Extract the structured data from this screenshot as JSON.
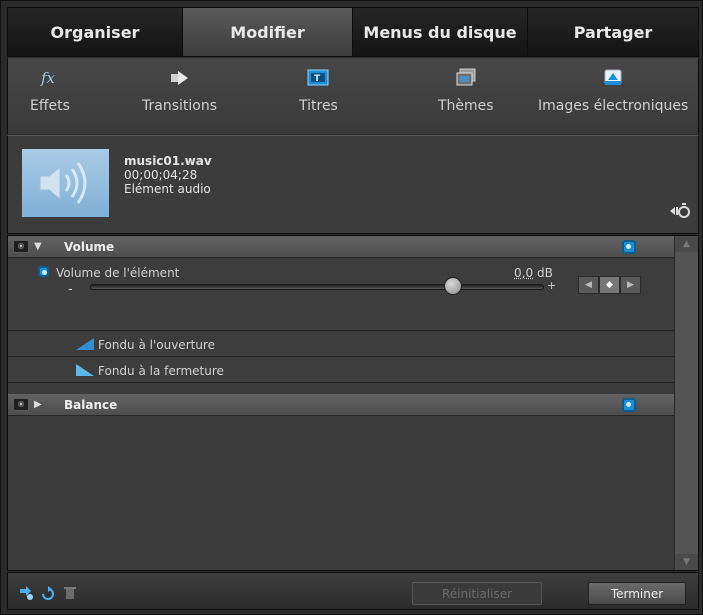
{
  "tabs": [
    {
      "label": "Organiser",
      "state": "inactive"
    },
    {
      "label": "Modifier",
      "state": "active"
    },
    {
      "label": "Menus du disque",
      "state": "inactive"
    },
    {
      "label": "Partager",
      "state": "inactive"
    }
  ],
  "tools": [
    {
      "label": "Effets",
      "icon": "fx-icon"
    },
    {
      "label": "Transitions",
      "icon": "transition-arrow-icon"
    },
    {
      "label": "Titres",
      "icon": "title-icon"
    },
    {
      "label": "Thèmes",
      "icon": "themes-icon"
    },
    {
      "label": "Images électroniques",
      "icon": "disc-images-icon"
    }
  ],
  "clip": {
    "filename": "music01.wav",
    "duration": "00;00;04;28",
    "type": "Elément audio"
  },
  "properties": {
    "volume": {
      "title": "Volume",
      "item_label": "Volume de l'élément",
      "value": "0,0",
      "unit": "dB",
      "minus": "-",
      "plus": "+",
      "slider_position": 0.8
    },
    "fade_in": "Fondu à l'ouverture",
    "fade_out": "Fondu à la fermeture",
    "balance": {
      "title": "Balance"
    }
  },
  "footer": {
    "reset_label": "Réinitialiser",
    "done_label": "Terminer"
  },
  "colors": {
    "accent": "#1b8fd3",
    "fade_in_icon": "#2f8fd0",
    "fade_out_icon": "#5cb8e8"
  }
}
